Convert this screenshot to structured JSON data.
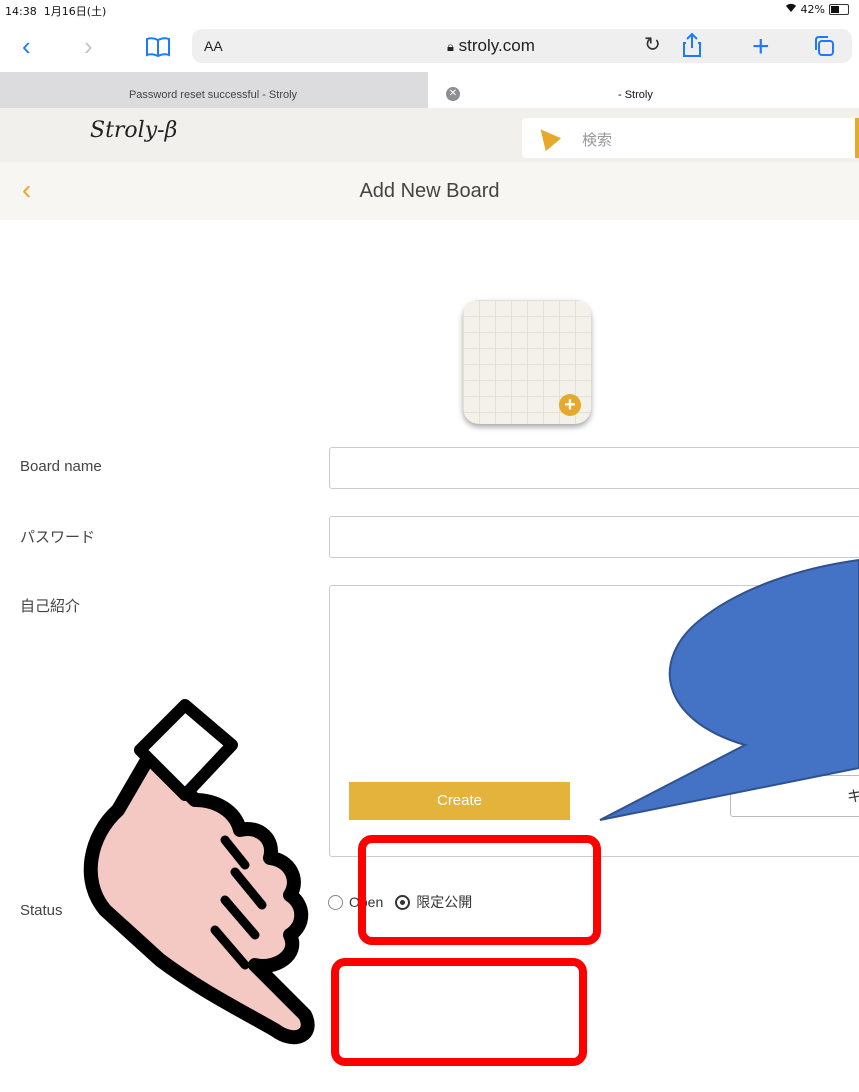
{
  "status_bar": {
    "time": "14:38",
    "date": "1月16日(土)",
    "battery": "42%"
  },
  "browser": {
    "text_size_label": "AA",
    "url": "stroly.com",
    "tabs": [
      {
        "title": "Password reset successful - Stroly"
      },
      {
        "title": "- Stroly"
      }
    ]
  },
  "site": {
    "logo": "Stroly-β",
    "search_placeholder": "検索"
  },
  "page": {
    "title": "Add New Board"
  },
  "form": {
    "board_name_label": "Board name",
    "board_name_value": "",
    "password_label": "パスワード",
    "password_value": "",
    "intro_label": "自己紹介",
    "intro_value": "",
    "status_label": "Status",
    "status_options": [
      {
        "label": "Open",
        "selected": false
      },
      {
        "label": "限定公開",
        "selected": true
      }
    ],
    "create_label": "Create",
    "cancel_label": "キ"
  },
  "colors": {
    "accent": "#e3b33b",
    "callout": "#4472c4",
    "highlight": "#ff0000"
  }
}
